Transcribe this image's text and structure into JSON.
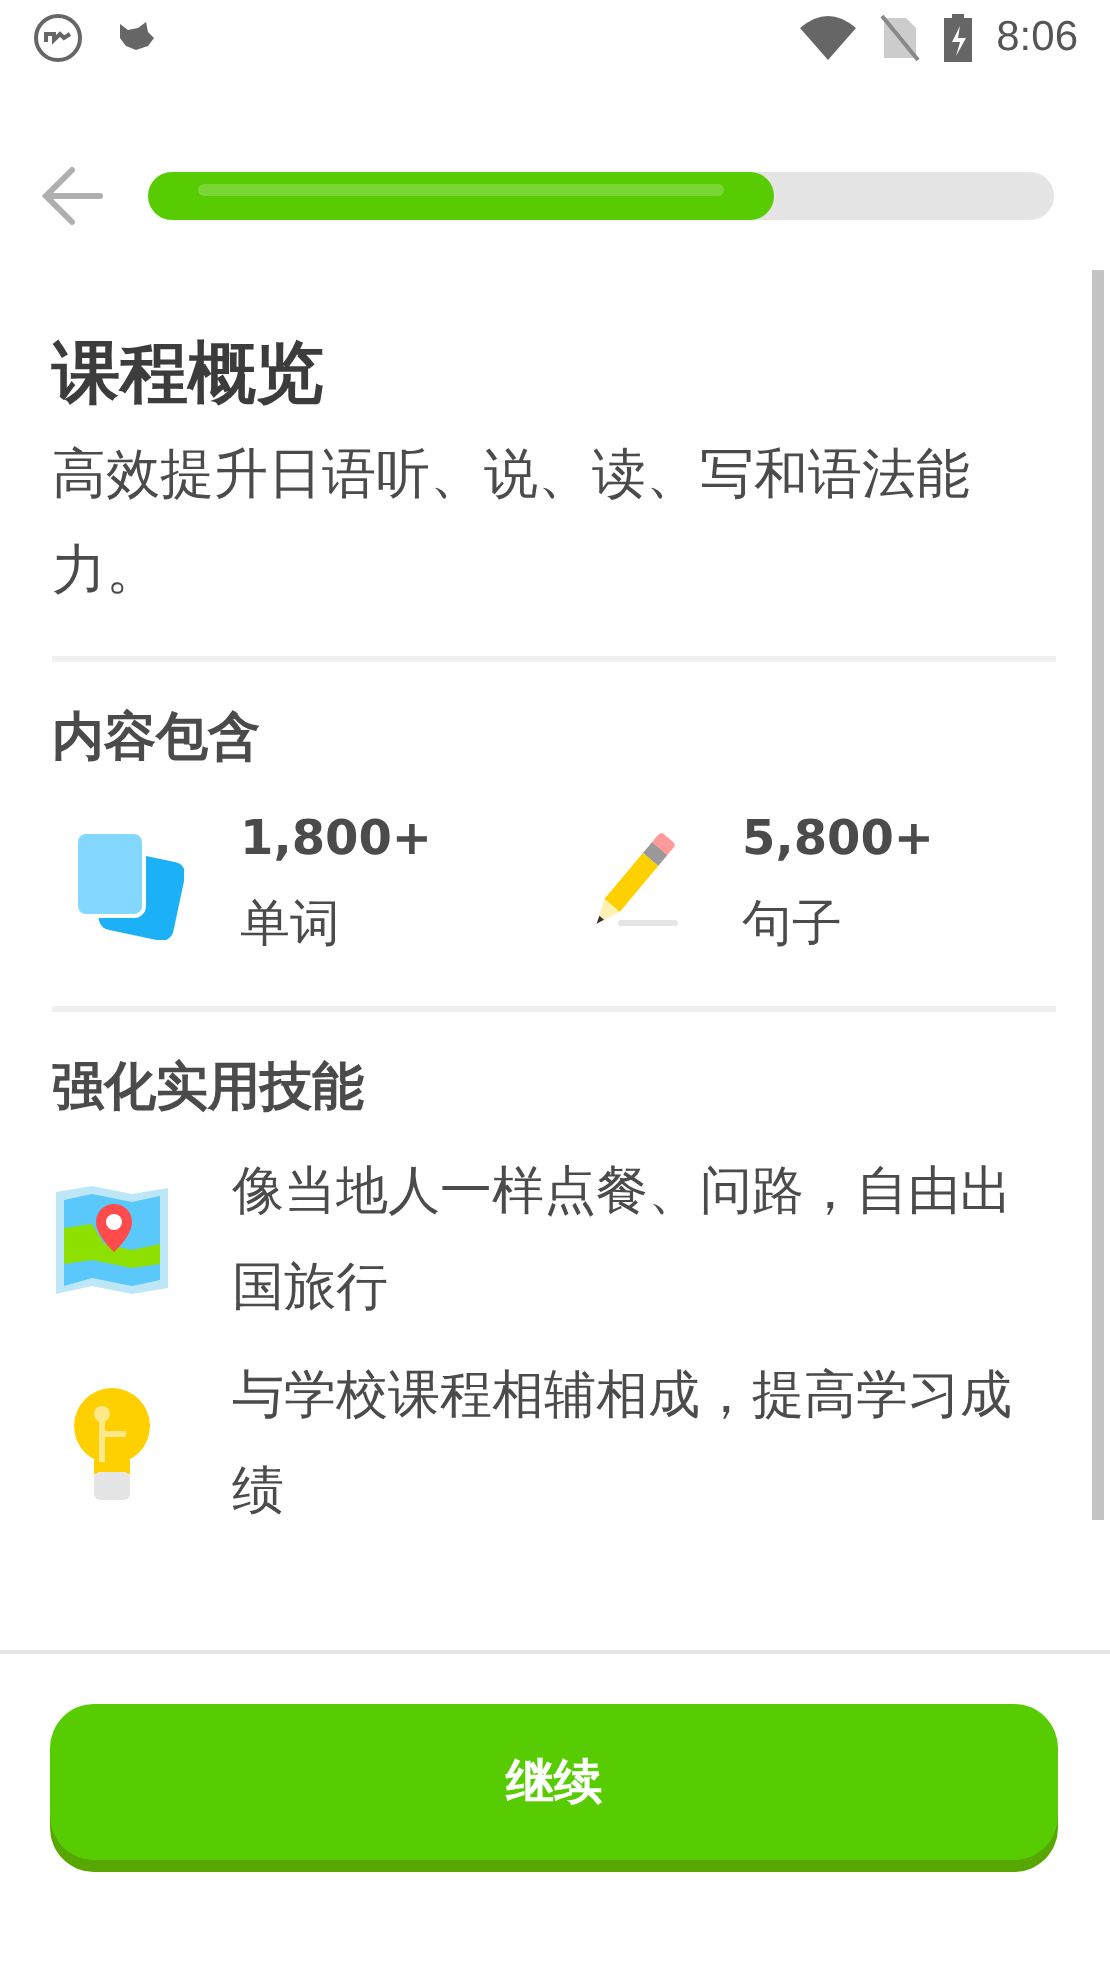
{
  "status_bar": {
    "time": "8:06"
  },
  "progress": {
    "level": 0.69
  },
  "overview": {
    "title": "课程概览",
    "description": "高效提升日语听、说、读、写和语法能力。"
  },
  "contents": {
    "heading": "内容包含",
    "stats": [
      {
        "kind": "cards",
        "count": "1,800+",
        "label": "单词"
      },
      {
        "kind": "pencil",
        "count": "5,800+",
        "label": "句子"
      }
    ]
  },
  "skills": {
    "heading": "强化实用技能",
    "items": [
      {
        "kind": "map",
        "text": "像当地人一样点餐、问路，自由出国旅行"
      },
      {
        "kind": "bulb",
        "text": "与学校课程相辅相成，提高学习成绩"
      }
    ]
  },
  "continue_button": {
    "label": "继续"
  }
}
